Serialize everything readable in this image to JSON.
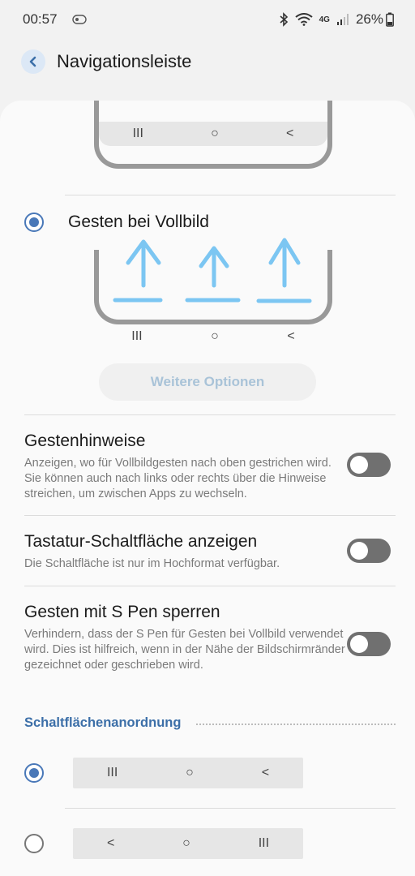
{
  "status": {
    "time": "00:57",
    "network": "4G",
    "battery": "26%"
  },
  "header": {
    "title": "Navigationsleiste"
  },
  "preview": {
    "nav_recents": "III",
    "nav_home": "○",
    "nav_back": "<"
  },
  "gestures": {
    "label": "Gesten bei Vollbild",
    "more_options": "Weitere Optionen"
  },
  "settings": [
    {
      "title": "Gestenhinweise",
      "desc": "Anzeigen, wo für Vollbildgesten nach oben gestrichen wird. Sie können auch nach links oder rechts über die Hinweise streichen, um zwischen Apps zu wechseln.",
      "enabled": false
    },
    {
      "title": "Tastatur-Schaltfläche anzeigen",
      "desc": "Die Schaltfläche ist nur im Hochformat verfügbar.",
      "enabled": false
    },
    {
      "title": "Gesten mit S Pen sperren",
      "desc": "Verhindern, dass der S Pen für Gesten bei Vollbild verwendet wird. Dies ist hilfreich, wenn in der Nähe der Bildschirmränder gezeichnet oder geschrieben wird.",
      "enabled": false
    }
  ],
  "order_section": {
    "title": "Schaltflächenanordnung",
    "options": [
      {
        "selected": true,
        "buttons": [
          "III",
          "○",
          "<"
        ]
      },
      {
        "selected": false,
        "buttons": [
          "<",
          "○",
          "III"
        ]
      }
    ]
  },
  "colors": {
    "accent": "#4978b8",
    "gesture_hint": "#7cc6f2",
    "toggle_off": "#707070"
  }
}
